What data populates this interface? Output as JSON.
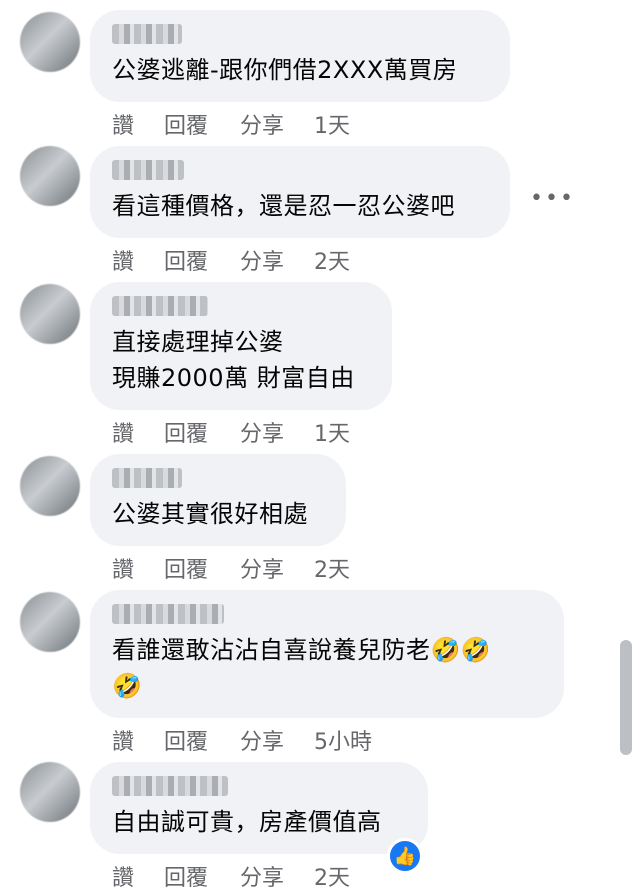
{
  "actions": {
    "like": "讚",
    "reply": "回覆",
    "share": "分享"
  },
  "comments": [
    {
      "text": "公婆逃離-跟你們借2XXX萬買房",
      "time": "1天"
    },
    {
      "text": "看這種價格，還是忍一忍公婆吧",
      "time": "2天"
    },
    {
      "text": "直接處理掉公婆\n現賺2000萬 財富自由",
      "time": "1天"
    },
    {
      "text": "公婆其實很好相處",
      "time": "2天"
    },
    {
      "text": "看誰還敢沾沾自喜說養兒防老🤣🤣\n🤣",
      "time": "5小時"
    },
    {
      "text": "自由誠可貴，房產價值高",
      "time": "2天"
    }
  ],
  "more_glyph": "•••",
  "like_glyph": "👍"
}
